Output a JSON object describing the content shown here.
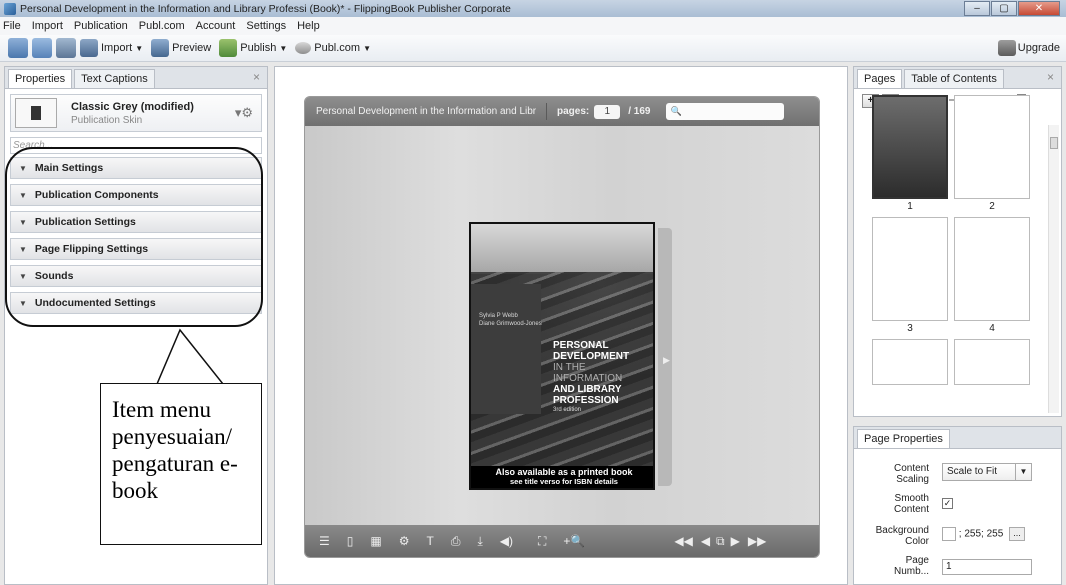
{
  "window": {
    "title": "Personal Development in the Information and Library Professi (Book)* - FlippingBook Publisher Corporate"
  },
  "menu": [
    "File",
    "Import",
    "Publication",
    "Publ.com",
    "Account",
    "Settings",
    "Help"
  ],
  "toolbar": {
    "import": "Import",
    "preview": "Preview",
    "publish": "Publish",
    "publcom": "Publ.com",
    "upgrade": "Upgrade"
  },
  "left_panel": {
    "tabs": [
      "Properties",
      "Text Captions"
    ],
    "skin_name": "Classic Grey (modified)",
    "skin_sub": "Publication Skin",
    "search_placeholder": "Search...",
    "settings": [
      "Main Settings",
      "Publication Components",
      "Publication Settings",
      "Page Flipping Settings",
      "Sounds",
      "Undocumented Settings"
    ]
  },
  "callout": {
    "text": "Item menu penyesuaian/ pengaturan e-book"
  },
  "viewer": {
    "title": "Personal Development in the Information and Libra...",
    "pages_label": "pages:",
    "page": "1",
    "total": "/ 169",
    "cover": {
      "authors_line1": "Sylvia P Webb",
      "authors_line2": "Diane Grimwood-Jones",
      "title1": "PERSONAL",
      "title2": "DEVELOPMENT",
      "title3": "IN THE",
      "title4": "INFORMATION",
      "title5": "AND LIBRARY",
      "title6": "PROFESSION",
      "edition": "3rd edition",
      "bottom1": "Also available as a printed book",
      "bottom2": "see title verso for ISBN details"
    }
  },
  "right_panel": {
    "tabs": [
      "Pages",
      "Table of Contents"
    ],
    "page_numbers": [
      "1",
      "2",
      "3",
      "4"
    ]
  },
  "page_properties": {
    "tab": "Page Properties",
    "content_scaling_label": "Content Scaling",
    "content_scaling_value": "Scale to Fit",
    "smooth_content_label": "Smooth Content",
    "smooth_checked": "✓",
    "background_color_label": "Background Color",
    "background_color_value": "; 255; 255",
    "page_number_label": "Page Numb...",
    "page_number_value": "1"
  }
}
